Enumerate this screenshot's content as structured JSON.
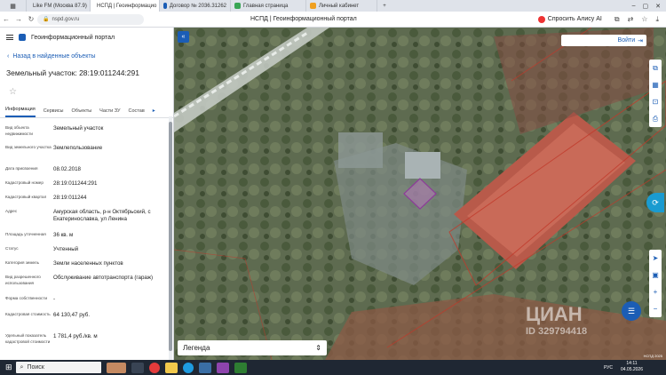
{
  "browser": {
    "tabs": [
      {
        "label": "Like FM (Москва 87.9)",
        "color": "#e33b3b",
        "active": false
      },
      {
        "label": "НСПД | Геоинформацио",
        "color": "#1b5db5",
        "active": true
      },
      {
        "label": "Договор № 2036.31262",
        "color": "#1b5db5",
        "active": false
      },
      {
        "label": "Главная страница",
        "color": "#3aa655",
        "active": false
      },
      {
        "label": "Личный кабинет",
        "color": "#f0a020",
        "active": false
      }
    ],
    "url": "nspd.gov.ru",
    "page_title": "НСПД | Геоинформационный портал",
    "alisa_label": "Спросить Алису AI"
  },
  "panel": {
    "portal_title": "Геоинформационный портал",
    "back_label": "Назад в найденные объекты",
    "object_title": "Земельный участок: 28:19:011244:291",
    "tabs": [
      "Информация",
      "Сервисы",
      "Объекты",
      "Части ЗУ",
      "Состав"
    ],
    "rows": [
      {
        "k": "Вид объекта недвижимости",
        "v": "Земельный участок"
      },
      {
        "k": "Вид земельного участка",
        "v": "Землепользование"
      },
      {
        "k": "Дата присвоения",
        "v": "08.02.2018"
      },
      {
        "k": "Кадастровый номер",
        "v": "28:19:011244:291"
      },
      {
        "k": "Кадастровый квартал",
        "v": "28:19:011244"
      },
      {
        "k": "Адрес",
        "v": "Амурская область, р-н Октябрьский, с Екатеринославка, ул Ленина"
      },
      {
        "k": "Площадь уточненная",
        "v": "36 кв. м"
      },
      {
        "k": "Статус",
        "v": "Учтенный"
      },
      {
        "k": "Категория земель",
        "v": "Земли населенных пунктов"
      },
      {
        "k": "Вид разрешенного использования",
        "v": "Обслуживание автотранспорта (гараж)"
      },
      {
        "k": "Форма собственности",
        "v": "-"
      },
      {
        "k": "Кадастровая стоимость",
        "v": "64 130,47 руб."
      },
      {
        "k": "Удельный показатель кадастровой стоимости",
        "v": "1 781,4 руб./кв. м"
      }
    ]
  },
  "map": {
    "login_label": "Войти",
    "legend_label": "Легенда",
    "watermark": "ЦИАН",
    "watermark_id": "ID 329794418",
    "scale_text": "НСПД 2025"
  },
  "taskbar": {
    "search_label": "Поиск",
    "time": "14:11",
    "date": "04.05.2026",
    "lang": "РУС"
  }
}
